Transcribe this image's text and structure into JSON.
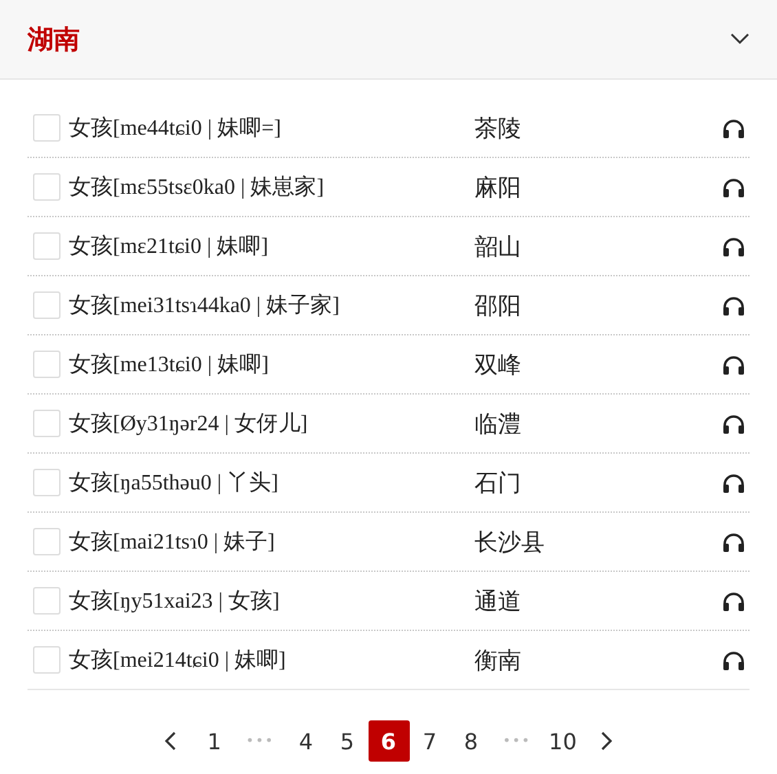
{
  "header": {
    "title": "湖南",
    "expanded": true
  },
  "rows": [
    {
      "word": "女孩[me44tɕi0 | 妹唧=]",
      "place": "茶陵",
      "checked": false
    },
    {
      "word": "女孩[mɛ55tsɛ0ka0 | 妹崽家]",
      "place": "麻阳",
      "checked": false
    },
    {
      "word": "女孩[mɛ21tɕi0 | 妹唧]",
      "place": "韶山",
      "checked": false
    },
    {
      "word": "女孩[mei31tsɿ44ka0 | 妹子家]",
      "place": "邵阳",
      "checked": false
    },
    {
      "word": "女孩[me13tɕi0 | 妹唧]",
      "place": "双峰",
      "checked": false
    },
    {
      "word": "女孩[Øy31ŋər24 | 女伢儿]",
      "place": "临澧",
      "checked": false
    },
    {
      "word": "女孩[ŋa55thəu0 | 丫头]",
      "place": "石门",
      "checked": false
    },
    {
      "word": "女孩[mai21tsɿ0 | 妹子]",
      "place": "长沙县",
      "checked": false
    },
    {
      "word": "女孩[ŋy51xai23 | 女孩]",
      "place": "通道",
      "checked": false
    },
    {
      "word": "女孩[mei214tɕi0 | 妹唧]",
      "place": "衡南",
      "checked": false
    }
  ],
  "pagination": [
    {
      "kind": "prev"
    },
    {
      "kind": "page",
      "label": "1",
      "selected": false
    },
    {
      "kind": "ellipsis",
      "label": "•••"
    },
    {
      "kind": "page",
      "label": "4",
      "selected": false
    },
    {
      "kind": "page",
      "label": "5",
      "selected": false
    },
    {
      "kind": "page",
      "label": "6",
      "selected": true
    },
    {
      "kind": "page",
      "label": "7",
      "selected": false
    },
    {
      "kind": "page",
      "label": "8",
      "selected": false
    },
    {
      "kind": "ellipsis",
      "label": "•••"
    },
    {
      "kind": "page",
      "label": "10",
      "selected": false
    },
    {
      "kind": "next"
    }
  ]
}
